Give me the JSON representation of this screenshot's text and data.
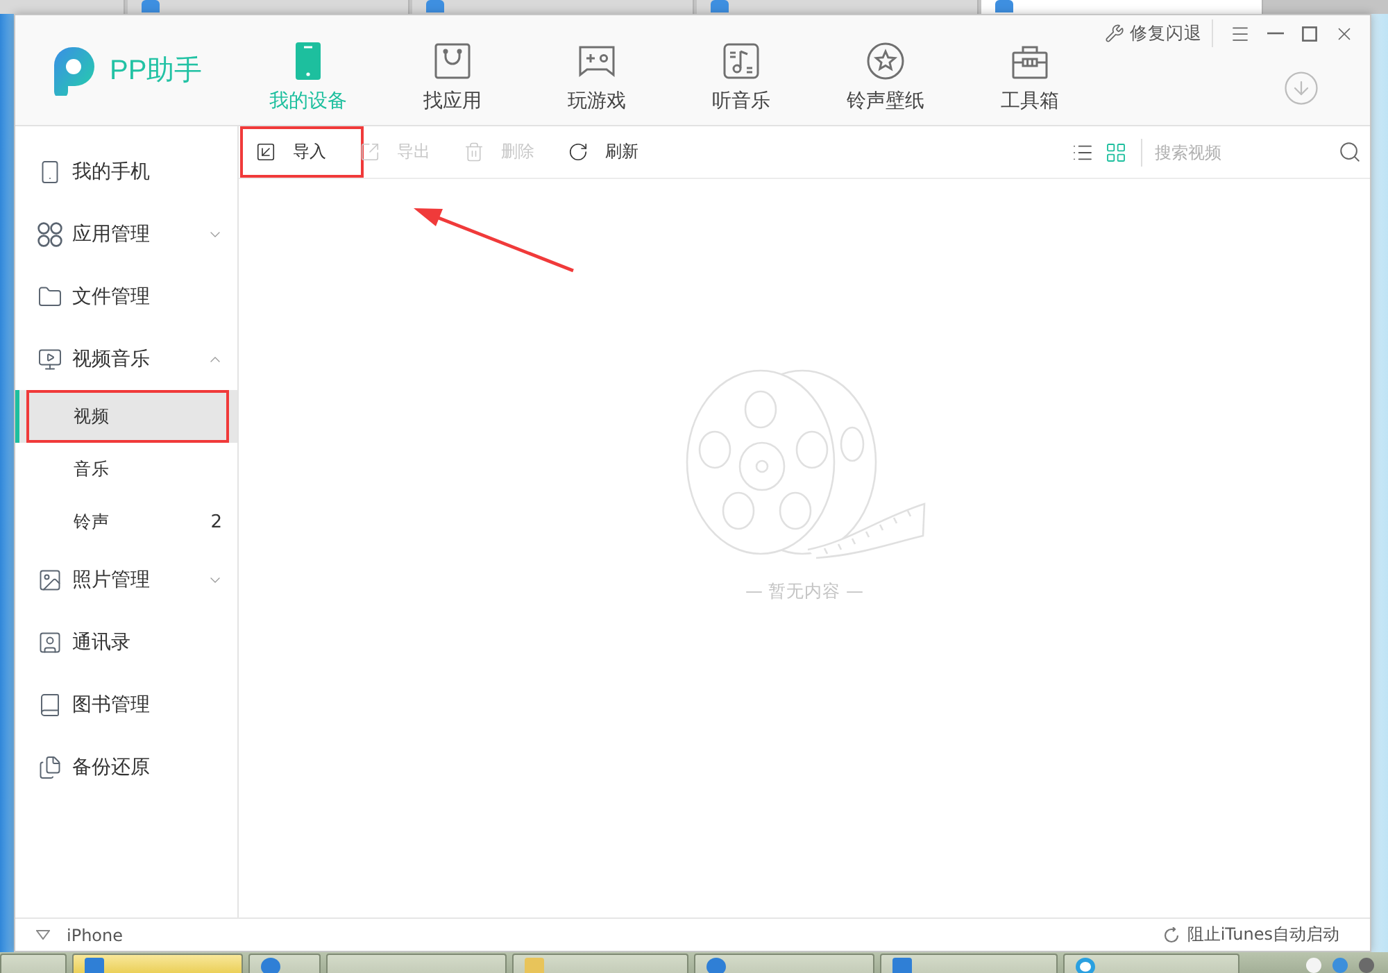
{
  "browser_tabs": [
    {
      "selected": false
    },
    {
      "selected": false
    },
    {
      "selected": false
    },
    {
      "selected": false
    },
    {
      "selected": true
    }
  ],
  "app": {
    "logo_text": "PP助手",
    "repair_label": "修复闪退"
  },
  "nav_tabs": [
    {
      "label": "我的设备",
      "selected": true
    },
    {
      "label": "找应用",
      "selected": false
    },
    {
      "label": "玩游戏",
      "selected": false
    },
    {
      "label": "听音乐",
      "selected": false
    },
    {
      "label": "铃声壁纸",
      "selected": false
    },
    {
      "label": "工具箱",
      "selected": false
    }
  ],
  "sidebar": {
    "items": [
      {
        "label": "我的手机",
        "selected": false
      },
      {
        "label": "应用管理",
        "selected": false,
        "expanded": false
      },
      {
        "label": "文件管理",
        "selected": false
      },
      {
        "label": "视频音乐",
        "selected": false,
        "expanded": true,
        "children": [
          {
            "label": "视频",
            "selected": true,
            "annotated": true
          },
          {
            "label": "音乐",
            "selected": false,
            "annotated": false
          },
          {
            "label": "铃声",
            "selected": false,
            "annotated": false,
            "count": "2"
          }
        ]
      },
      {
        "label": "照片管理",
        "selected": false,
        "expanded": false
      },
      {
        "label": "通讯录",
        "selected": false
      },
      {
        "label": "图书管理",
        "selected": false
      },
      {
        "label": "备份还原",
        "selected": false
      }
    ]
  },
  "toolbar": {
    "actions": [
      {
        "label": "导入",
        "disabled": false,
        "annotated": true
      },
      {
        "label": "导出",
        "disabled": true,
        "annotated": false
      },
      {
        "label": "删除",
        "disabled": true,
        "annotated": false
      },
      {
        "label": "刷新",
        "disabled": false,
        "annotated": false
      }
    ],
    "views": [
      {
        "selected": false
      },
      {
        "selected": true
      }
    ],
    "search": {
      "placeholder": "搜索视频"
    }
  },
  "content": {
    "empty_text": "— 暂无内容 —",
    "annotation_arrow": true
  },
  "status_bar": {
    "device": "iPhone",
    "itunes_option": "阻止iTunes自动启动"
  },
  "taskbar": {
    "buttons": [
      {
        "selected": false
      },
      {
        "selected": true
      },
      {
        "selected": false
      },
      {
        "selected": false
      },
      {
        "selected": false
      },
      {
        "selected": false
      },
      {
        "selected": false
      },
      {
        "selected": false
      }
    ]
  }
}
